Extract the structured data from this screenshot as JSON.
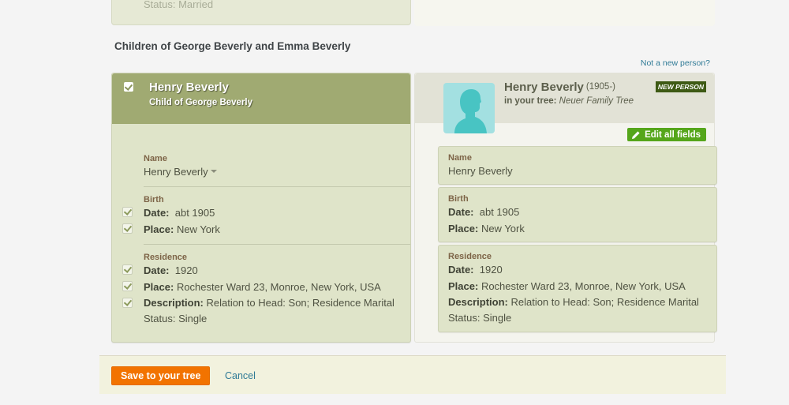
{
  "previous_card": {
    "text": "Status: Married"
  },
  "section_title": "Children of George Beverly and Emma Beverly",
  "not_new_person_link": "Not a new person?",
  "record": {
    "name": "Henry Beverly",
    "relationship": "Child of George Beverly",
    "name_label": "Name",
    "name_value": "Henry Beverly",
    "birth": {
      "label": "Birth",
      "date_label": "Date:",
      "date": "abt 1905",
      "place_label": "Place:",
      "place": "New York"
    },
    "residence": {
      "label": "Residence",
      "date_label": "Date:",
      "date": "1920",
      "place_label": "Place:",
      "place": "Rochester Ward 23, Monroe, New York, USA",
      "description_label": "Description:",
      "description": "Relation to Head: Son; Residence Marital Status: Single"
    }
  },
  "tree_person": {
    "name": "Henry Beverly",
    "years": "(1905-)",
    "tree_label": "in your tree:",
    "tree_name": "Neuer Family Tree",
    "badge": "NEW PERSON",
    "edit_button": "Edit all fields",
    "name_label": "Name",
    "name_value": "Henry Beverly",
    "birth": {
      "label": "Birth",
      "date_label": "Date:",
      "date": "abt 1905",
      "place_label": "Place:",
      "place": "New York"
    },
    "residence": {
      "label": "Residence",
      "date_label": "Date:",
      "date": "1920",
      "place_label": "Place:",
      "place": "Rochester Ward 23, Monroe, New York, USA",
      "description_label": "Description:",
      "description": "Relation to Head: Son; Residence Marital Status: Single"
    }
  },
  "footer": {
    "save_label": "Save to your tree",
    "cancel_label": "Cancel"
  },
  "colors": {
    "accent_orange": "#f27300",
    "link_blue": "#2f7a96",
    "header_olive": "#a0aa72",
    "edit_green": "#55a61b",
    "badge_green": "#3e5a14"
  }
}
